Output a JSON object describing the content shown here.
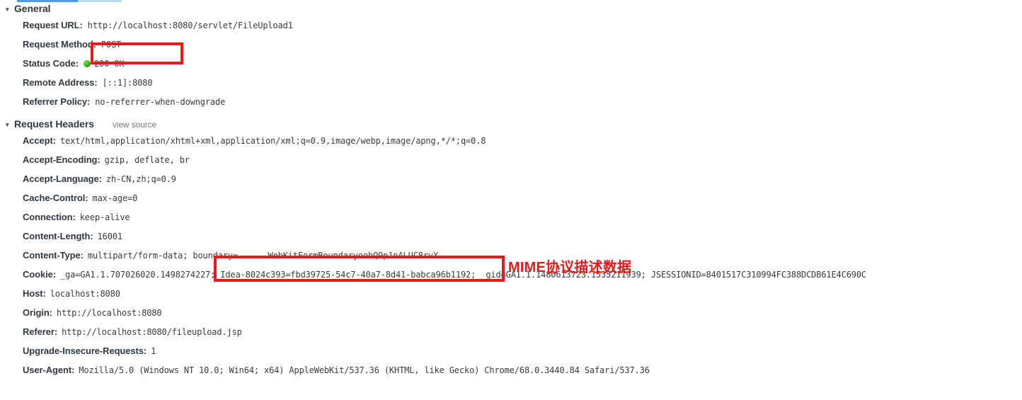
{
  "panel": {
    "sections": [
      {
        "id": "general",
        "twisty": "▾",
        "title": "General",
        "view_source": null,
        "rows": [
          {
            "name": "Request URL:",
            "value": "http://localhost:8080/servlet/FileUpload1"
          },
          {
            "name": "Request Method:",
            "value": "POST"
          },
          {
            "name": "Status Code:",
            "value": "200 OK",
            "dot": true
          },
          {
            "name": "Remote Address:",
            "value": "[::1]:8080"
          },
          {
            "name": "Referrer Policy:",
            "value": "no-referrer-when-downgrade"
          }
        ]
      },
      {
        "id": "request-headers",
        "twisty": "▾",
        "title": "Request Headers",
        "view_source": "view source",
        "rows": [
          {
            "name": "Accept:",
            "value": "text/html,application/xhtml+xml,application/xml;q=0.9,image/webp,image/apng,*/*;q=0.8"
          },
          {
            "name": "Accept-Encoding:",
            "value": "gzip, deflate, br"
          },
          {
            "name": "Accept-Language:",
            "value": "zh-CN,zh;q=0.9"
          },
          {
            "name": "Cache-Control:",
            "value": "max-age=0"
          },
          {
            "name": "Connection:",
            "value": "keep-alive"
          },
          {
            "name": "Content-Length:",
            "value": "16001"
          },
          {
            "name": "Content-Type:",
            "value": "multipart/form-data; boundary=------WebKitFormBoundaryoohQ9p1nALUC8rvX"
          },
          {
            "name": "Cookie:",
            "value": "_ga=GA1.1.707026020.1498274227; Idea-8024c393=fbd39725-54c7-40a7-8d41-babca96b1192; _gid=GA1.1.1480613723.1535211939; JSESSIONID=8401517C310994FC388DCDB61E4C690C"
          },
          {
            "name": "Host:",
            "value": "localhost:8080"
          },
          {
            "name": "Origin:",
            "value": "http://localhost:8080"
          },
          {
            "name": "Referer:",
            "value": "http://localhost:8080/fileupload.jsp"
          },
          {
            "name": "Upgrade-Insecure-Requests:",
            "value": "1"
          },
          {
            "name": "User-Agent:",
            "value": "Mozilla/5.0 (Windows NT 10.0; Win64; x64) AppleWebKit/537.36 (KHTML, like Gecko) Chrome/68.0.3440.84 Safari/537.36"
          }
        ]
      }
    ]
  },
  "annotations": {
    "accent_color": "#e8191b",
    "box_request_method": "POST",
    "box_boundary": "boundary=------WebKitFormBoundaryoohQ9p1nALUC8rvX",
    "label_mime": "MIME协议描述数据"
  },
  "chrome": {
    "active_tab_color": "#4a9fd5",
    "status_ok_color": "#27b10d"
  }
}
